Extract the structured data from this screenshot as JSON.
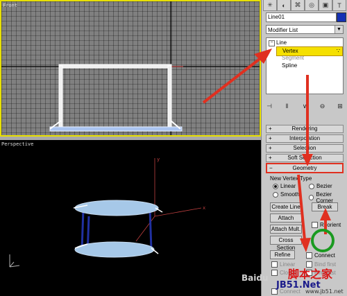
{
  "viewports": {
    "front_label": "Front",
    "perspective_label": "Perspective"
  },
  "panel": {
    "object_name": "Line01",
    "object_color": "#1430b4",
    "modifier_list": "Modifier List",
    "stack": {
      "line": "Line",
      "vertex": "Vertex",
      "segment": "Segment",
      "spline": "Spline"
    },
    "rollouts": {
      "rendering": "Rendering",
      "interpolation": "Interpolation",
      "selection": "Selection",
      "soft_selection": "Soft Selection",
      "geometry": "Geometry"
    },
    "new_vertex_type": "New Vertex Type",
    "radio": {
      "linear": "Linear",
      "bezier": "Bezier",
      "smooth": "Smooth",
      "bezier_corner": "Bezier Corner"
    },
    "buttons": {
      "create_line": "Create Line",
      "break": "Break",
      "attach": "Attach",
      "attach_mult": "Attach Mult.",
      "reorient": "Reorient",
      "cross_section": "Cross Section",
      "refine": "Refine",
      "connect": "Connect",
      "linear": "Linear",
      "bind_first": "Bind first",
      "closed": "Closed",
      "bind_last": "Bind last",
      "connect2": "Connect"
    }
  },
  "annotation": {
    "accent": "#e03020",
    "circle": "#1a9a20"
  },
  "watermark": {
    "left": "Baidu",
    "site": "脚本之家",
    "url": "www.jb51.net",
    "jb": "JB51.Net"
  }
}
